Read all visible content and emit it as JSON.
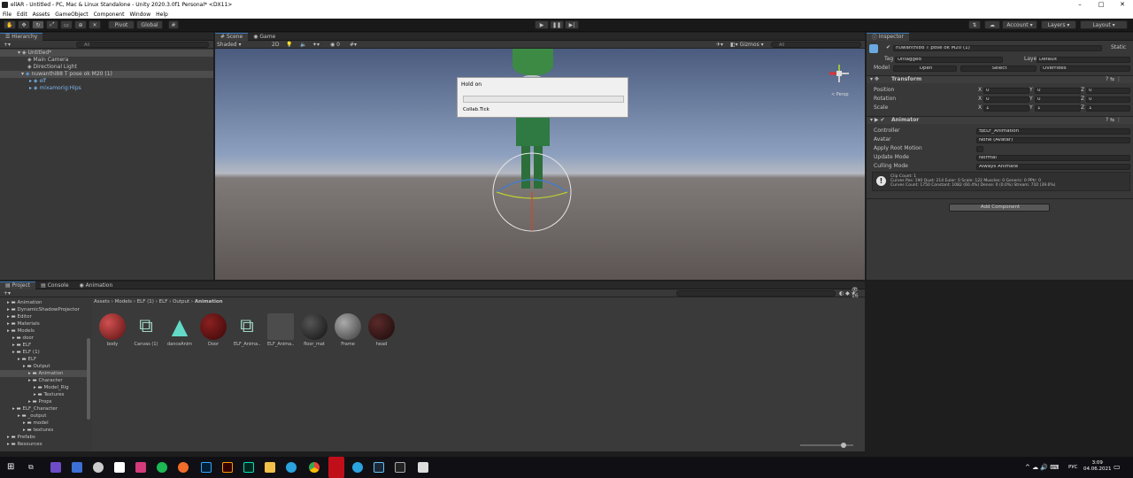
{
  "window": {
    "title": "ellAR - Untitled - PC, Mac & Linux Standalone - Unity 2020.3.0f1 Personal* <DX11>",
    "min": "–",
    "max": "□",
    "close": "✕"
  },
  "menu": [
    "File",
    "Edit",
    "Assets",
    "GameObject",
    "Component",
    "Window",
    "Help"
  ],
  "toolbar": {
    "pivot": "Pivot",
    "global": "Global",
    "account": "Account",
    "layers": "Layers",
    "layout": "Layout"
  },
  "hierarchy": {
    "tab": "Hierarchy",
    "search_placeholder": "All",
    "items": [
      {
        "label": "Untitled*"
      },
      {
        "label": "Main Camera"
      },
      {
        "label": "Directional Light"
      },
      {
        "label": "nuwanthi88 T pose ok M20 (1)"
      },
      {
        "label": "elf"
      },
      {
        "label": "mixamorig:Hips"
      }
    ]
  },
  "scene": {
    "tabs": [
      "Scene",
      "Game"
    ],
    "shading": "Shaded",
    "mode2d": "2D",
    "gizmos": "Gizmos",
    "search_placeholder": "All",
    "persp": "< Persp"
  },
  "dialog": {
    "title": "Hold on",
    "message": "Collab.Tick",
    "progress": 0
  },
  "inspector": {
    "tab": "Inspector",
    "object_name": "nuwanthi88 T pose ok M20 (1)",
    "static": "Static",
    "tag_label": "Tag",
    "tag": "Untagged",
    "layer_label": "Layer",
    "layer": "Default",
    "model_label": "Model",
    "open": "Open",
    "select": "Select",
    "overrides": "Overrides",
    "transform": {
      "title": "Transform",
      "rows": [
        {
          "label": "Position",
          "x": "0",
          "y": "0",
          "z": "0"
        },
        {
          "label": "Rotation",
          "x": "0",
          "y": "0",
          "z": "0"
        },
        {
          "label": "Scale",
          "x": "1",
          "y": "1",
          "z": "1"
        }
      ]
    },
    "animator": {
      "title": "Animator",
      "controller_label": "Controller",
      "controller": "ELF_Animation",
      "avatar_label": "Avatar",
      "avatar": "None (Avatar)",
      "root_motion_label": "Apply Root Motion",
      "update_label": "Update Mode",
      "update": "Normal",
      "culling_label": "Culling Mode",
      "culling": "Always Animate",
      "info1": "Clip Count: 1",
      "info2": "Curves Pos: 190 Quat: 214 Euler: 0 Scale: 122 Muscles: 0 Generic: 0 PPtr: 0",
      "info3": "Curves Count: 1750 Constant: 1082 (60.4%) Dense: 0 (0.0%) Stream: 710 (39.6%)"
    },
    "add_component": "Add Component"
  },
  "project": {
    "tabs": [
      "Project",
      "Console",
      "Animation"
    ],
    "count": "16",
    "breadcrumb": [
      "Assets",
      "Models",
      "ELF (1)",
      "ELF",
      "Output",
      "Animation"
    ],
    "tree": [
      {
        "label": "Animation",
        "indent": 1
      },
      {
        "label": "DynamicShadowProjector",
        "indent": 1
      },
      {
        "label": "Editor",
        "indent": 1
      },
      {
        "label": "Materials",
        "indent": 1
      },
      {
        "label": "Models",
        "indent": 1
      },
      {
        "label": "door",
        "indent": 2
      },
      {
        "label": "ELF",
        "indent": 2
      },
      {
        "label": "ELF (1)",
        "indent": 2
      },
      {
        "label": "ELF",
        "indent": 3
      },
      {
        "label": "Output",
        "indent": 4
      },
      {
        "label": "Animation",
        "indent": 5
      },
      {
        "label": "Character",
        "indent": 5
      },
      {
        "label": "Model_Rig",
        "indent": 6
      },
      {
        "label": "Textures",
        "indent": 6
      },
      {
        "label": "Props",
        "indent": 5
      },
      {
        "label": "ELF_Character",
        "indent": 2
      },
      {
        "label": "_output",
        "indent": 3
      },
      {
        "label": "model",
        "indent": 4
      },
      {
        "label": "textures",
        "indent": 4
      },
      {
        "label": "Prefabs",
        "indent": 1
      },
      {
        "label": "Resources",
        "indent": 1
      }
    ],
    "assets": [
      "body",
      "Canvas (1)",
      "danceAnim",
      "Door",
      "ELF_Anima...",
      "ELF_Anima...",
      "floor_mat",
      "Frame",
      "head"
    ]
  },
  "taskbar": {
    "lang": "РУС",
    "time": "3:09",
    "date": "04.06.2021"
  }
}
